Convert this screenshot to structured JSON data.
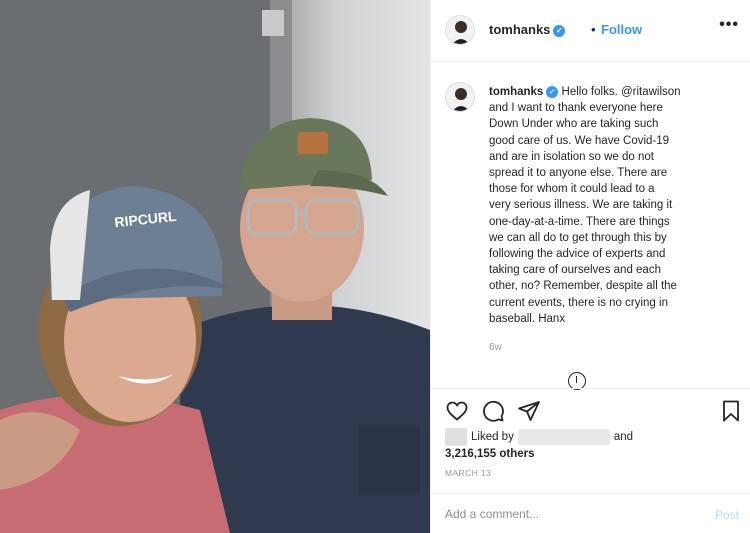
{
  "photo": {
    "cap_brand": "RIPCURL"
  },
  "post": {
    "username": "tomhanks",
    "verified_icon": "verified-badge-icon",
    "follow_label": "Follow",
    "more_label": "•••",
    "caption_user": "tomhanks",
    "caption_lines": [
      "Hello folks. @ritawilson",
      "and I want to thank everyone here",
      "Down Under who are taking such",
      "good care of us. We have Covid-19",
      "and are in isolation so we do not",
      "spread it to anyone else. There are",
      "those for whom it could lead to a",
      "very serious illness. We are taking it",
      "one-day-at-a-time. There are things",
      "we can all do to get through this by",
      "following the advice of experts and",
      "taking care of ourselves and each",
      "other, no? Remember, despite all the",
      "current events, there is no crying in",
      "baseball. Hanx"
    ],
    "time_ago": "6w",
    "likes_prefix": "Liked by",
    "likes_and": "and",
    "likes_others": "3,216,155 others",
    "date": "MARCH 13",
    "comment_placeholder": "Add a comment...",
    "post_label": "Post"
  },
  "colors": {
    "accent": "#3897f0",
    "post_disabled": "#b3dbff",
    "muted": "#999999"
  }
}
